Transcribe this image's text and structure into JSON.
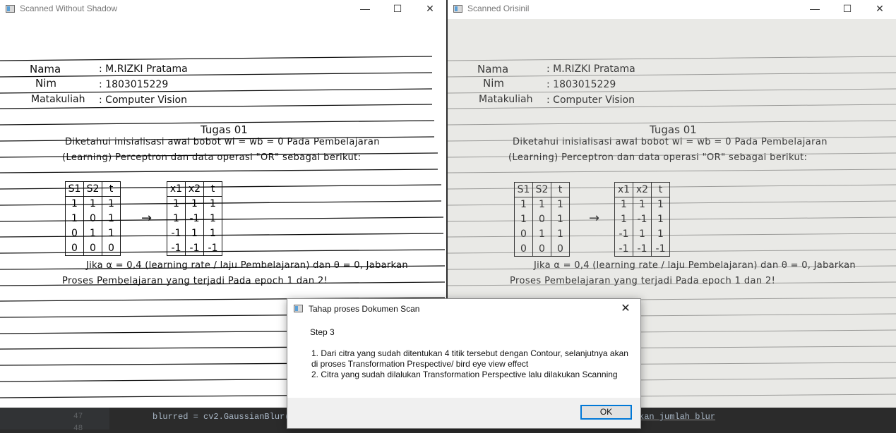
{
  "editor": {
    "line_numbers": [
      "47",
      "48"
    ],
    "code_line": "blurred = cv2.GaussianBlur(",
    "code_tail": "kan jumlah blur"
  },
  "left_window": {
    "title": "Scanned Without Shadow",
    "minimize_icon": "minimize-icon",
    "maximize_icon": "maximize-icon",
    "close_icon": "close-icon"
  },
  "right_window": {
    "title": "Scanned Orisinil",
    "minimize_icon": "minimize-icon",
    "maximize_icon": "maximize-icon",
    "close_icon": "close-icon"
  },
  "document": {
    "name_label": "Nama",
    "name_value": ": M.RIZKI Pratama",
    "nim_label": "Nim",
    "nim_value": ": 1803015229",
    "course_label": "Matakuliah",
    "course_value": ": Computer Vision",
    "heading": "Tugas 01",
    "line1": "Diketahui inisialisasi awal bobot wi = wb = 0 Pada Pembelajaran",
    "line2": "(Learning) Perceptron dan data operasi \"OR\" sebagai berikut:",
    "table1": {
      "headers": [
        "S1",
        "S2",
        "t"
      ],
      "rows": [
        [
          "1",
          "1",
          "1"
        ],
        [
          "1",
          "0",
          "1"
        ],
        [
          "0",
          "1",
          "1"
        ],
        [
          "0",
          "0",
          "0"
        ]
      ]
    },
    "arrow": "→",
    "table2": {
      "headers": [
        "x1",
        "x2",
        "t"
      ],
      "rows": [
        [
          "1",
          "1",
          "1"
        ],
        [
          "1",
          "-1",
          "1"
        ],
        [
          "-1",
          "1",
          "1"
        ],
        [
          "-1",
          "-1",
          "-1"
        ]
      ]
    },
    "line3": "Jika α = 0,4 (learning rate / laju Pembelajaran) dan θ = 0, Jabarkan",
    "line4": "Proses Pembelajaran yang terjadi Pada epoch 1 dan 2!"
  },
  "dialog": {
    "title": "Tahap proses Dokumen Scan",
    "step": "Step 3",
    "item1": "1. Dari citra yang sudah ditentukan 4 titik tersebut dengan Contour, selanjutnya akan di proses Transformation Prespective/ bird eye view effect",
    "item2": "2. Citra yang sudah dilalukan Transformation Perspective lalu dilakukan Scanning",
    "ok_label": "OK",
    "close_glyph": "✕"
  },
  "colors": {
    "accent": "#0078d7",
    "editor_bg": "#2b2b2b",
    "original_paper": "#e9e9e6"
  }
}
